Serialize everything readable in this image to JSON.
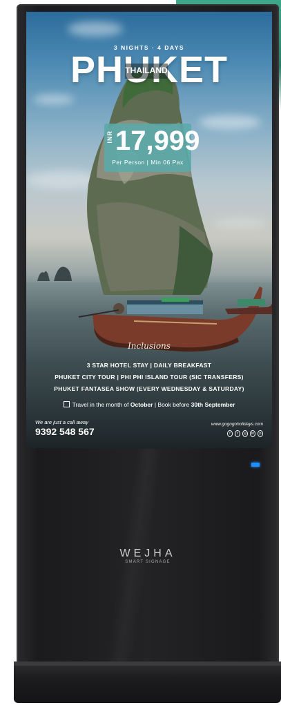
{
  "poster": {
    "subhead": "3 NIGHTS · 4 DAYS",
    "title": "PHUKET",
    "country": "THAILAND",
    "currency": "INR",
    "price": "17,999",
    "price_note": "Per Person | Min 06 Pax",
    "inclusions_heading": "Inclusions",
    "inclusions": [
      "3 STAR HOTEL STAY  |  DAILY BREAKFAST",
      "PHUKET CITY TOUR  |  PHI PHI ISLAND TOUR (SIC TRANSFERS)",
      "PHUKET FANTASEA SHOW (EVERY WEDNESDAY & SATURDAY)"
    ],
    "travel_prefix": "Travel in the month of ",
    "travel_month": "October",
    "travel_sep": " | Book before ",
    "travel_deadline": "30th September",
    "call_text": "We are just a call away",
    "phone": "9392 548 567",
    "website": "www.gogogoholidays.com",
    "social_icons": [
      "facebook-icon",
      "twitter-icon",
      "instagram-icon",
      "linkedin-icon",
      "pinterest-icon"
    ],
    "social_glyphs": [
      "f",
      "t",
      "◎",
      "in",
      "p"
    ]
  },
  "device": {
    "brand": "WEJHA",
    "tagline": "SMART SIGNAGE",
    "led_color": "#1f8fff"
  },
  "colors": {
    "accent_teal": "#3fa88a",
    "price_box": "#5aaaaa",
    "body_black": "#1b1b1d"
  }
}
